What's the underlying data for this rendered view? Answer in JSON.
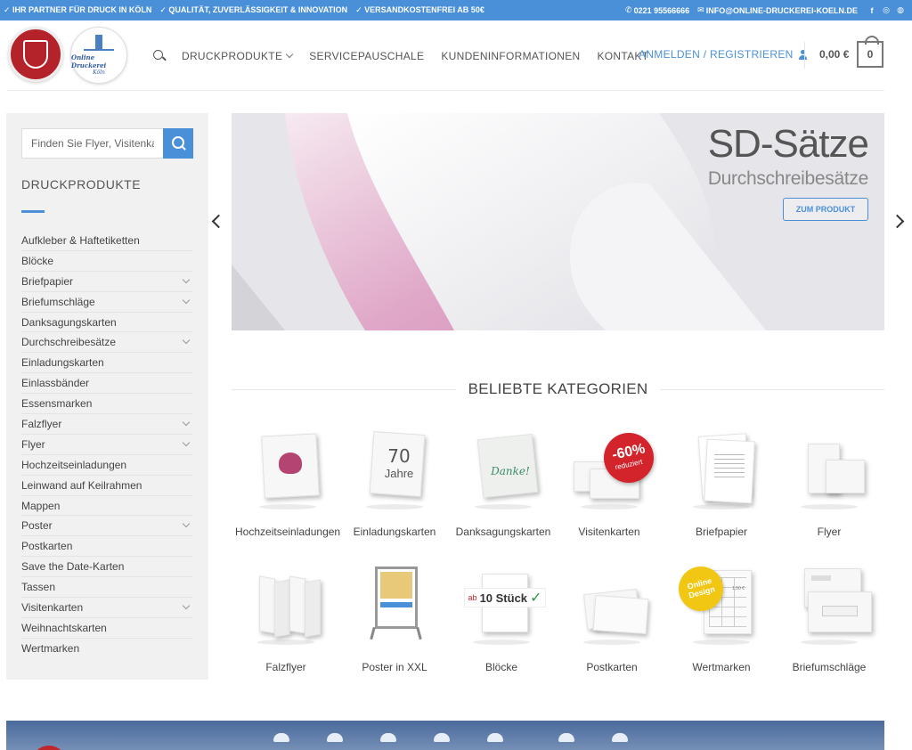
{
  "topbar": {
    "claims": [
      "✓ IHR PARTNER FÜR DRUCK IN KÖLN",
      "✓ QUALITÄT, ZUVERLÄSSIGKEIT & INNOVATION",
      "✓ VERSANDKOSTENFREI AB 50€"
    ],
    "phone": "0221 95566666",
    "email": "INFO@ONLINE-DRUCKEREI-KOELN.DE",
    "social_icons": [
      "facebook-icon",
      "instagram-icon",
      "globe-icon"
    ]
  },
  "header": {
    "logo_text_1": "Online Druckerei",
    "logo_text_2": "Köln",
    "nav": [
      "DRUCKPRODUKTE",
      "SERVICEPAUSCHALE",
      "KUNDENINFORMATIONEN",
      "KONTAKT"
    ],
    "login": "ANMELDEN / REGISTRIEREN",
    "cart_total": "0,00 €",
    "cart_count": "0"
  },
  "sidebar": {
    "search_placeholder": "Finden Sie Flyer, Visitenkarten...",
    "title": "DRUCKPRODUKTE",
    "items": [
      {
        "label": "Aufkleber & Haftetiketten",
        "expandable": false
      },
      {
        "label": "Blöcke",
        "expandable": false
      },
      {
        "label": "Briefpapier",
        "expandable": true
      },
      {
        "label": "Briefumschläge",
        "expandable": true
      },
      {
        "label": "Danksagungskarten",
        "expandable": false
      },
      {
        "label": "Durchschreibesätze",
        "expandable": true
      },
      {
        "label": "Einladungskarten",
        "expandable": false
      },
      {
        "label": "Einlassbänder",
        "expandable": false
      },
      {
        "label": "Essensmarken",
        "expandable": false
      },
      {
        "label": "Falzflyer",
        "expandable": true
      },
      {
        "label": "Flyer",
        "expandable": true
      },
      {
        "label": "Hochzeitseinladungen",
        "expandable": false
      },
      {
        "label": "Leinwand auf Keilrahmen",
        "expandable": false
      },
      {
        "label": "Mappen",
        "expandable": false
      },
      {
        "label": "Poster",
        "expandable": true
      },
      {
        "label": "Postkarten",
        "expandable": false
      },
      {
        "label": "Save the Date-Karten",
        "expandable": false
      },
      {
        "label": "Tassen",
        "expandable": false
      },
      {
        "label": "Visitenkarten",
        "expandable": true
      },
      {
        "label": "Weihnachtskarten",
        "expandable": false
      },
      {
        "label": "Wertmarken",
        "expandable": false
      }
    ]
  },
  "slider": {
    "title": "SD-Sätze",
    "subtitle": "Durchschreibesätze",
    "button": "ZUM PRODUKT"
  },
  "categories": {
    "heading": "BELIEBTE KATEGORIEN",
    "items": [
      {
        "label": "Hochzeitseinladungen"
      },
      {
        "label": "Einladungskarten",
        "image_text": [
          "70",
          "Jahre"
        ]
      },
      {
        "label": "Danksagungskarten",
        "image_text": [
          "Danke!"
        ]
      },
      {
        "label": "Visitenkarten",
        "image_text": [
          "-60%",
          "reduziert"
        ]
      },
      {
        "label": "Briefpapier"
      },
      {
        "label": "Flyer"
      },
      {
        "label": "Falzflyer"
      },
      {
        "label": "Poster in XXL"
      },
      {
        "label": "Blöcke",
        "image_text": [
          "ab",
          "10 Stück",
          "✓"
        ]
      },
      {
        "label": "Postkarten"
      },
      {
        "label": "Wertmarken",
        "image_text": [
          "Online",
          "Design",
          "1,50 €"
        ]
      },
      {
        "label": "Briefumschläge"
      }
    ]
  },
  "colors": {
    "accent": "#4a90d9",
    "logo_red": "#b5232a"
  }
}
